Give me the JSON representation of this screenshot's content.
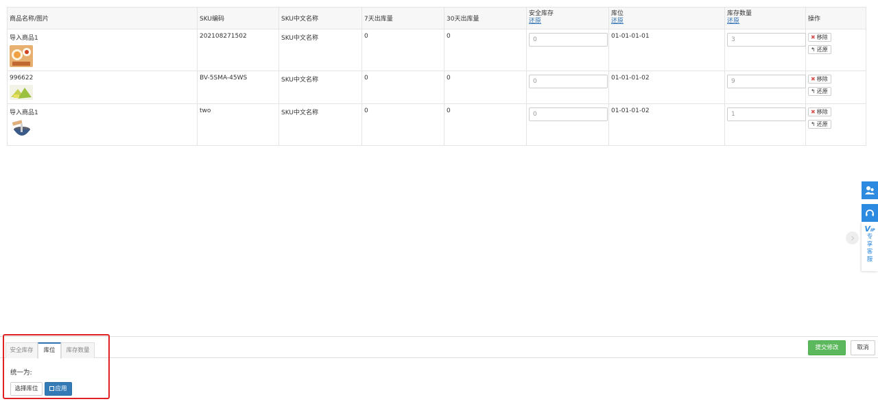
{
  "table": {
    "headers": {
      "name": "商品名称/图片",
      "sku_code": "SKU编码",
      "sku_cn": "SKU中文名称",
      "out7": "7天出库量",
      "out30": "30天出库量",
      "safety": "安全库存",
      "location": "库位",
      "qty": "库存数量",
      "ops": "操作",
      "restore": "还原"
    },
    "rows": [
      {
        "name": "导入商品1",
        "sku_code": "202108271502",
        "sku_cn": "SKU中文名称",
        "out7": "0",
        "out30": "0",
        "safety": "0",
        "location": "01-01-01-01",
        "qty": "3"
      },
      {
        "name": "996622",
        "sku_code": "BV-5SMA-45WS",
        "sku_cn": "SKU中文名称",
        "out7": "0",
        "out30": "0",
        "safety": "0",
        "location": "01-01-01-02",
        "qty": "9"
      },
      {
        "name": "导入商品1",
        "sku_code": "two",
        "sku_cn": "SKU中文名称",
        "out7": "0",
        "out30": "0",
        "safety": "0",
        "location": "01-01-01-02",
        "qty": "1"
      }
    ],
    "remove_label": "移除",
    "restore_label": "还原"
  },
  "bottom": {
    "tabs": [
      "安全库存",
      "库位",
      "库存数量"
    ],
    "active_tab": "库位",
    "unify_label": "统一为:",
    "select_location_button": "选择库位",
    "apply_button": "应用",
    "submit_button": "提交修改",
    "cancel_button": "取消"
  },
  "side": {
    "vip_mark": "V",
    "vip_sub": "IP",
    "vip_text": "专享客服"
  },
  "colors": {
    "primary": "#337ab7",
    "success": "#5cb85c",
    "side_blue": "#2c8ae0",
    "highlight_red": "#e02020"
  },
  "icons": [
    "remove-x-icon",
    "undo-arrow-icon",
    "save-icon",
    "customer-service-icon",
    "headset-icon",
    "chevron-right-icon"
  ]
}
